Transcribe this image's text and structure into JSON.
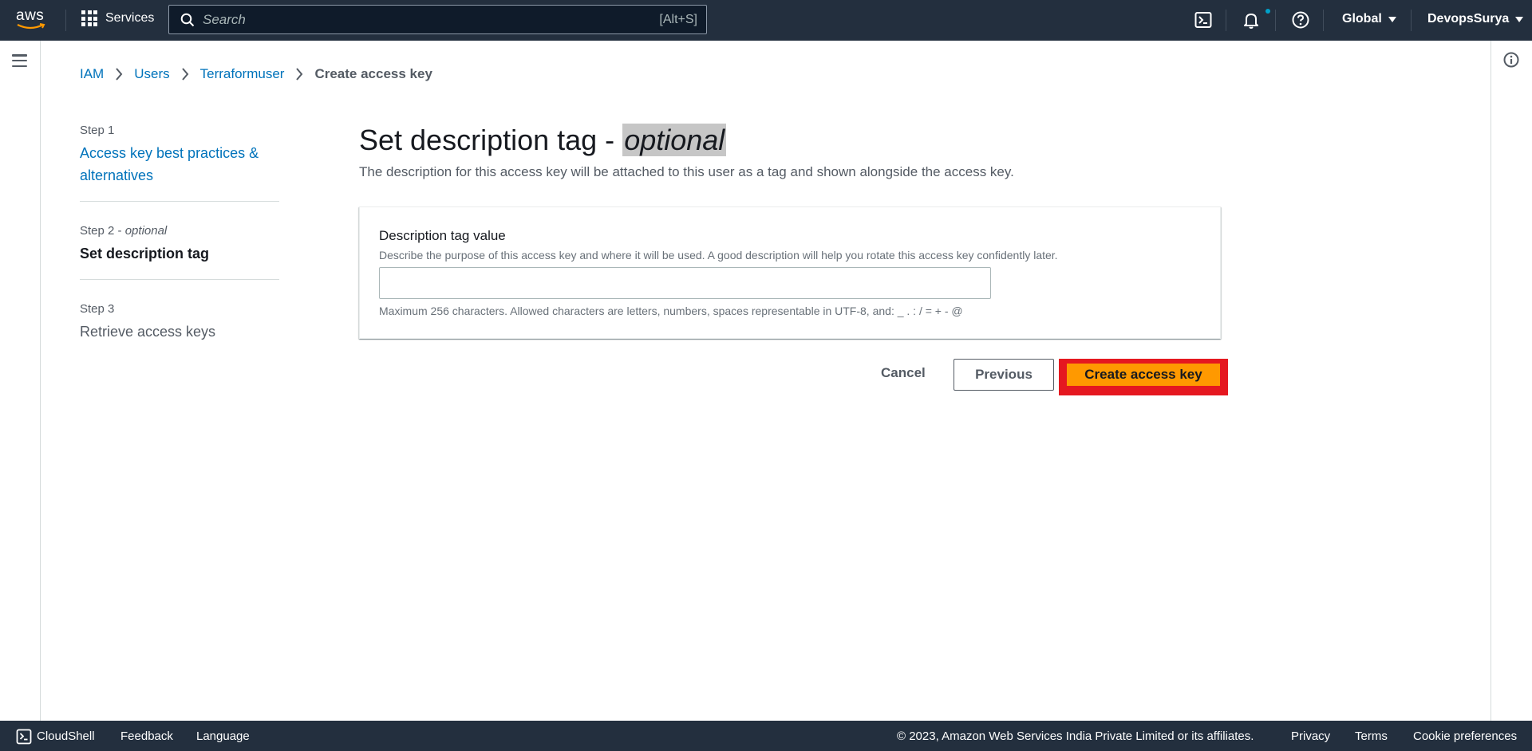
{
  "topnav": {
    "logo_text": "aws",
    "services_label": "Services",
    "search_placeholder": "Search",
    "search_shortcut": "[Alt+S]",
    "region_label": "Global",
    "user_label": "DevopsSurya"
  },
  "breadcrumb": {
    "items": [
      "IAM",
      "Users",
      "Terraformuser"
    ],
    "current": "Create access key"
  },
  "steps": [
    {
      "number": "Step 1",
      "title": "Access key best practices & alternatives"
    },
    {
      "number": "Step 2",
      "number_suffix": "optional",
      "title": "Set description tag"
    },
    {
      "number": "Step 3",
      "title": "Retrieve access keys"
    }
  ],
  "main": {
    "title": "Set description tag -",
    "title_optional": "optional",
    "description": "The description for this access key will be attached to this user as a tag and shown alongside the access key."
  },
  "form": {
    "label": "Description tag value",
    "description": "Describe the purpose of this access key and where it will be used. A good description will help you rotate this access key confidently later.",
    "value": "",
    "constraint": "Maximum 256 characters. Allowed characters are letters, numbers, spaces representable in UTF-8, and: _ . : / = + - @"
  },
  "actions": {
    "cancel": "Cancel",
    "previous": "Previous",
    "create": "Create access key"
  },
  "footer": {
    "cloudshell": "CloudShell",
    "feedback": "Feedback",
    "language": "Language",
    "copyright": "© 2023, Amazon Web Services India Private Limited or its affiliates.",
    "privacy": "Privacy",
    "terms": "Terms",
    "cookies": "Cookie preferences"
  },
  "colors": {
    "nav_bg": "#232f3e",
    "link": "#0073bb",
    "primary_button": "#ff9900",
    "highlight_border": "#e51820"
  }
}
